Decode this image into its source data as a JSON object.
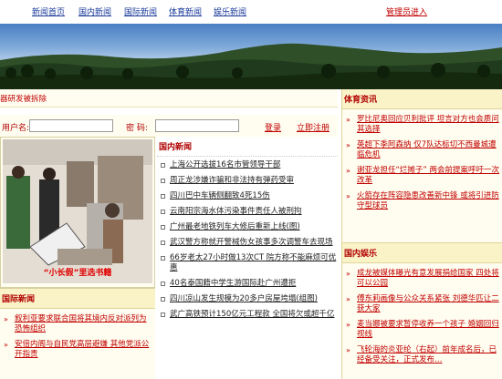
{
  "nav": {
    "items": [
      "新闻首页",
      "国内新闻",
      "国际新闻",
      "体育新闻",
      "娱乐新闻"
    ],
    "admin_login": "管理员进入"
  },
  "ticker": {
    "text": "器研发被拆除"
  },
  "login": {
    "username_label": "用户名:",
    "password_label": "密  码:",
    "login_link": "登录",
    "register_link": "立即注册"
  },
  "photo": {
    "caption": "“小长假”里选书籍"
  },
  "china_news": {
    "title": "国内新闻",
    "items": [
      "上海公开选拔16名市管领导干部",
      "周正龙涉嫌诈骗和非法持有弹药受审",
      "四川巴中车辆侧翻致4死15伤",
      "云南阳宗海水体污染事件责任人被刑拘",
      "广州最老地铁列车大修后重新上线(图)",
      "武汉警方称就开警械伤女孩事多次调警车去现场",
      "66岁老太27小时做13次CT 院方称不能麻烦可优惠",
      "40名泰国籍中学生游国际赴广州遭拒",
      "四川凉山发生规模为20多户房屋垮塌(组图)",
      "武广高铁预计150亿元工程款 全国将欠或超千亿"
    ]
  },
  "intl_news": {
    "title": "国际新闻",
    "items": [
      "叙利亚要求联合国将其境内反对派列为恐怖组织",
      "安倍内阁与自民党高层避嫌 其他党派公开指责"
    ]
  },
  "sports_news": {
    "title": "体育资讯",
    "items": [
      "罗比尼奥回应贝利批评 坦言对方也会质问其选择",
      "英超下季阿森纳 仅7队达标切不西曼城遭临危机",
      "谢亚龙担任“烂摊子” 两会前提案呼吁一次改革",
      "火箭存在阵容隐患改善新中锋 或将引进防守型球员"
    ]
  },
  "ent_news": {
    "title": "国内娱乐",
    "items": [
      "成龙被媒体曝光有意发展捐给国家 四处将可以公园",
      "傅东莉画像与公众关系紧张 刘德华匹让二获大家",
      "麦当娜被要求暂停收养一个孩子 婚姻回归视线",
      "飞轮海的炎亚纶（右起）前年成名后，已经备受关注，正式发布…"
    ]
  }
}
